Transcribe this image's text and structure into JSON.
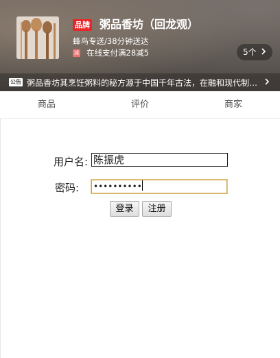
{
  "header": {
    "brand_badge": "品牌",
    "shop_name": "粥品香坊（回龙观）",
    "delivery": "蜂鸟专送/38分钟送达",
    "promo_badge": "减",
    "promo_text": "在线支付满28减5",
    "promo_count": "5个",
    "notice_badge": "公告",
    "notice_text": "粥品香坊其烹饪粥料的秘方源于中国千年古法，在融和现代制作工艺..."
  },
  "tabs": [
    {
      "label": "商品"
    },
    {
      "label": "评价"
    },
    {
      "label": "商家"
    }
  ],
  "login_form": {
    "username_label": "用户名:",
    "username_value": "陈振虎",
    "password_label": "密码:",
    "password_value": "••••••••••",
    "login_button": "登录",
    "register_button": "注册"
  },
  "icons": {
    "chevron": "chevron-right-icon"
  },
  "colors": {
    "brand_red": "#e8262a",
    "promo_pink": "#f07373",
    "focus_border": "#c8a24a"
  }
}
